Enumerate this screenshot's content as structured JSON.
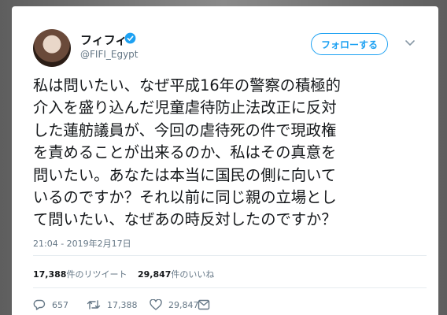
{
  "user": {
    "display_name": "フィフィ",
    "handle": "@FIFI_Egypt"
  },
  "follow_label": "フォローする",
  "tweet": {
    "text": "私は問いたい、なぜ平成16年の警察の積極的\n介入を盛り込んだ児童虐待防止法改正に反対\nした蓮舫議員が、今回の虐待死の件で現政権\nを責めることが出来るのか、私はその真意を\n問いたい。あなたは本当に国民の側に向いて\nいるのですか？それ以前に同じ親の立場とし\nて問いたい、なぜあの時反対したのですか？",
    "timestamp": "21:04 - 2019年2月17日"
  },
  "stats": {
    "retweets_count": "17,388",
    "retweets_label": "件のリツイート",
    "likes_count": "29,847",
    "likes_label": "件のいいね"
  },
  "actions": {
    "reply_count": "657",
    "retweet_count": "17,388",
    "like_count": "29,847"
  },
  "colors": {
    "accent": "#1da1f2",
    "text": "#14171a",
    "muted": "#657786"
  },
  "icons": [
    "verified-badge-icon",
    "chevron-down-icon",
    "reply-icon",
    "retweet-icon",
    "heart-icon",
    "dm-icon"
  ]
}
